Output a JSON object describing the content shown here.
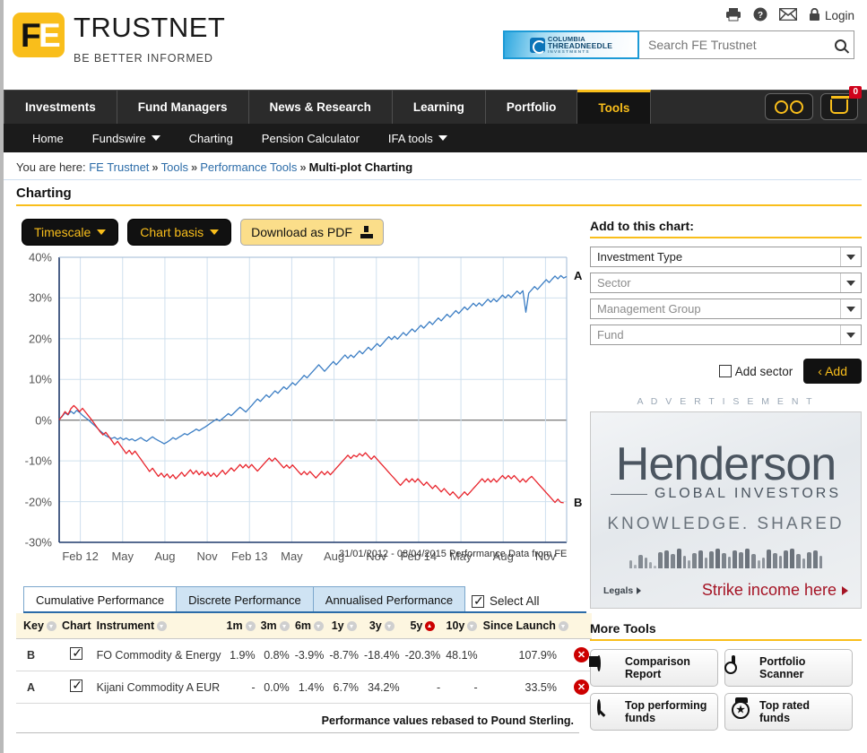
{
  "brand": {
    "logo_f": "F",
    "logo_e": "E",
    "name": "TRUSTNET",
    "tagline": "BE BETTER INFORMED"
  },
  "header": {
    "print_icon": "printer-icon",
    "help_icon": "help-icon",
    "mail_icon": "mail-icon",
    "lock_icon": "lock-icon",
    "login_label": "Login",
    "ad_banner": {
      "line1": "COLUMBIA",
      "line2": "THREADNEEDLE",
      "line3": "INVESTMENTS"
    },
    "search": {
      "placeholder": "Search FE Trustnet",
      "value": "",
      "icon": "search-icon"
    }
  },
  "nav": {
    "items": [
      {
        "label": "Investments",
        "active": false
      },
      {
        "label": "Fund Managers",
        "active": false
      },
      {
        "label": "News & Research",
        "active": false
      },
      {
        "label": "Learning",
        "active": false
      },
      {
        "label": "Portfolio",
        "active": false
      },
      {
        "label": "Tools",
        "active": true
      }
    ],
    "watchlist_icon": "glasses-icon",
    "basket_icon": "basket-icon",
    "basket_count": "0"
  },
  "subnav": {
    "items": [
      {
        "label": "Home",
        "has_caret": false
      },
      {
        "label": "Fundswire",
        "has_caret": true
      },
      {
        "label": "Charting",
        "has_caret": false
      },
      {
        "label": "Pension Calculator",
        "has_caret": false
      },
      {
        "label": "IFA tools",
        "has_caret": true
      }
    ]
  },
  "breadcrumb": {
    "prefix": "You are here:",
    "items": [
      "FE Trustnet",
      "Tools",
      "Performance Tools"
    ],
    "current": "Multi-plot Charting",
    "separator": "»"
  },
  "page_title": "Charting",
  "toolbar": {
    "timescale_label": "Timescale",
    "chart_basis_label": "Chart basis",
    "download_label": "Download as PDF",
    "download_icon": "download-icon"
  },
  "chart_data": {
    "type": "line",
    "title": "",
    "xlabel": "",
    "ylabel": "",
    "ylim": [
      -30,
      40
    ],
    "ytick_labels": [
      "40%",
      "30%",
      "20%",
      "10%",
      "0%",
      "-10%",
      "-20%",
      "-30%"
    ],
    "yticks": [
      40,
      30,
      20,
      10,
      0,
      -10,
      -20,
      -30
    ],
    "xtick_labels": [
      "Feb 12",
      "May",
      "Aug",
      "Nov",
      "Feb 13",
      "May",
      "Aug",
      "Nov",
      "Feb 14",
      "May",
      "Aug",
      "Nov"
    ],
    "grid": true,
    "legend_position": "right-edge-labels",
    "footer_left": "31/01/2012 - 08/04/2015",
    "footer_right": "Performance Data from FE",
    "series": [
      {
        "name": "A",
        "label": "A",
        "instrument": "Kijani Commodity A EUR",
        "color": "#3C7EC4",
        "end_value": 33.5,
        "values": [
          0.2,
          0.9,
          1.8,
          1.3,
          2.2,
          1.6,
          2.4,
          1.9,
          1.2,
          0.6,
          0.1,
          -0.6,
          -1.2,
          -1.9,
          -2.6,
          -3.2,
          -3.8,
          -4.2,
          -4.5,
          -4.2,
          -4.7,
          -4.3,
          -4.8,
          -4.4,
          -4.9,
          -4.6,
          -5.1,
          -4.7,
          -4.3,
          -4.8,
          -5.2,
          -4.6,
          -4.1,
          -4.6,
          -5.0,
          -5.4,
          -5.8,
          -5.4,
          -4.9,
          -4.3,
          -4.7,
          -4.2,
          -3.8,
          -3.3,
          -3.6,
          -3.1,
          -2.7,
          -2.2,
          -2.6,
          -2.1,
          -1.7,
          -1.2,
          -0.7,
          -0.2,
          0.3,
          -0.2,
          0.4,
          1.0,
          1.6,
          1.1,
          1.8,
          2.5,
          3.2,
          2.6,
          2.0,
          2.8,
          3.6,
          4.4,
          5.2,
          4.6,
          5.4,
          6.2,
          5.6,
          6.4,
          7.2,
          6.6,
          7.4,
          8.2,
          7.6,
          8.4,
          9.2,
          8.6,
          9.4,
          10.2,
          11.0,
          10.4,
          11.2,
          12.0,
          12.8,
          13.6,
          12.8,
          12.0,
          12.8,
          13.6,
          14.4,
          13.6,
          14.4,
          15.2,
          16.0,
          15.2,
          16.0,
          15.4,
          16.2,
          17.0,
          16.3,
          17.1,
          17.9,
          17.2,
          18.0,
          18.8,
          18.1,
          18.9,
          19.7,
          20.5,
          19.8,
          20.6,
          19.9,
          20.7,
          21.5,
          20.8,
          21.6,
          22.4,
          21.7,
          22.5,
          23.3,
          22.6,
          23.4,
          24.2,
          23.5,
          24.3,
          25.1,
          24.4,
          25.2,
          26.0,
          25.3,
          26.1,
          26.9,
          26.2,
          27.0,
          27.8,
          27.1,
          27.9,
          28.7,
          28.0,
          28.8,
          28.1,
          28.9,
          29.7,
          29.0,
          29.8,
          29.1,
          29.9,
          30.7,
          30.0,
          30.8,
          30.1,
          30.9,
          31.7,
          31.0,
          31.8,
          26.5,
          31.2,
          32.0,
          32.8,
          32.1,
          32.9,
          33.7,
          34.5,
          33.8,
          34.6,
          35.4,
          34.7,
          35.5,
          34.9,
          35.3
        ]
      },
      {
        "name": "B",
        "label": "B",
        "instrument": "FO Commodity & Energy",
        "color": "#E8242C",
        "end_value": -20.3,
        "values": [
          0.1,
          1.0,
          2.1,
          1.4,
          2.8,
          3.6,
          2.9,
          2.1,
          2.9,
          2.0,
          1.1,
          0.2,
          -0.8,
          -1.8,
          -2.8,
          -3.6,
          -3.0,
          -4.0,
          -5.0,
          -6.0,
          -5.2,
          -6.2,
          -7.2,
          -8.2,
          -7.4,
          -8.4,
          -7.6,
          -8.6,
          -9.6,
          -10.6,
          -11.6,
          -12.6,
          -11.8,
          -12.8,
          -13.8,
          -13.0,
          -14.0,
          -13.2,
          -14.2,
          -13.4,
          -14.4,
          -13.6,
          -12.8,
          -13.8,
          -13.0,
          -12.2,
          -13.2,
          -12.4,
          -13.4,
          -12.6,
          -13.6,
          -12.8,
          -13.8,
          -13.0,
          -13.9,
          -13.1,
          -12.3,
          -13.3,
          -12.5,
          -11.7,
          -12.5,
          -11.7,
          -10.9,
          -11.7,
          -10.9,
          -11.7,
          -10.9,
          -11.7,
          -12.5,
          -11.7,
          -10.9,
          -10.1,
          -9.3,
          -10.1,
          -9.3,
          -10.1,
          -10.9,
          -11.7,
          -11.0,
          -11.8,
          -11.0,
          -11.8,
          -12.6,
          -13.4,
          -12.6,
          -13.4,
          -12.6,
          -13.4,
          -14.2,
          -13.4,
          -12.6,
          -13.4,
          -12.6,
          -13.4,
          -12.6,
          -11.8,
          -11.0,
          -10.2,
          -9.4,
          -8.6,
          -9.4,
          -8.6,
          -9.0,
          -8.2,
          -8.8,
          -8.0,
          -8.8,
          -9.6,
          -8.8,
          -9.6,
          -10.4,
          -11.2,
          -12.0,
          -12.8,
          -13.6,
          -14.4,
          -15.2,
          -16.0,
          -15.2,
          -14.4,
          -15.2,
          -14.4,
          -15.2,
          -14.4,
          -15.2,
          -16.0,
          -15.2,
          -16.0,
          -16.8,
          -16.0,
          -16.8,
          -17.6,
          -16.8,
          -17.6,
          -18.4,
          -17.6,
          -18.4,
          -19.2,
          -18.4,
          -17.6,
          -18.4,
          -17.6,
          -16.8,
          -16.0,
          -15.2,
          -14.4,
          -15.2,
          -14.4,
          -15.2,
          -14.4,
          -15.2,
          -14.4,
          -13.6,
          -14.4,
          -13.6,
          -14.4,
          -13.6,
          -14.4,
          -15.2,
          -14.4,
          -15.2,
          -14.4,
          -13.8,
          -14.6,
          -15.4,
          -16.2,
          -17.0,
          -17.8,
          -18.6,
          -19.4,
          -20.2,
          -19.4,
          -20.2,
          -20.3
        ]
      }
    ]
  },
  "tabs": {
    "items": [
      {
        "label": "Cumulative Performance",
        "active": true
      },
      {
        "label": "Discrete Performance",
        "active": false
      },
      {
        "label": "Annualised Performance",
        "active": false
      }
    ],
    "select_all_label": "Select All",
    "select_all_checked": true
  },
  "table": {
    "columns": [
      {
        "label": "Key",
        "sortable": true,
        "sorted": false
      },
      {
        "label": "Chart",
        "sortable": false,
        "sorted": false
      },
      {
        "label": "Instrument",
        "sortable": true,
        "sorted": false
      },
      {
        "label": "1m",
        "sortable": true,
        "sorted": false
      },
      {
        "label": "3m",
        "sortable": true,
        "sorted": false
      },
      {
        "label": "6m",
        "sortable": true,
        "sorted": false
      },
      {
        "label": "1y",
        "sortable": true,
        "sorted": false
      },
      {
        "label": "3y",
        "sortable": true,
        "sorted": false
      },
      {
        "label": "5y",
        "sortable": true,
        "sorted": true
      },
      {
        "label": "10y",
        "sortable": true,
        "sorted": false
      },
      {
        "label": "Since Launch",
        "sortable": true,
        "sorted": false
      }
    ],
    "rows": [
      {
        "key": "B",
        "key_color": "#E0202A",
        "checked": true,
        "instrument": "FO Commodity & Energy",
        "m1": "1.9%",
        "m3": "0.8%",
        "m6": "-3.9%",
        "y1": "-8.7%",
        "y3": "-18.4%",
        "y5": "-20.3%",
        "y10": "48.1%",
        "since_launch": "107.9%",
        "remove_icon": "remove-icon"
      },
      {
        "key": "A",
        "key_color": "#2C6CA8",
        "checked": true,
        "instrument": "Kijani Commodity A EUR",
        "m1": "-",
        "m3": "0.0%",
        "m6": "1.4%",
        "y1": "6.7%",
        "y3": "34.2%",
        "y5": "-",
        "y10": "-",
        "since_launch": "33.5%",
        "remove_icon": "remove-icon"
      }
    ],
    "footnote": "Performance values rebased to Pound Sterling."
  },
  "add_panel": {
    "heading": "Add to this chart:",
    "selects": [
      {
        "value": "Investment Type",
        "is_placeholder": false
      },
      {
        "value": "Sector",
        "is_placeholder": true
      },
      {
        "value": "Management Group",
        "is_placeholder": true
      },
      {
        "value": "Fund",
        "is_placeholder": true
      }
    ],
    "add_sector_label": "Add sector",
    "add_sector_checked": false,
    "add_button_label": "‹ Add"
  },
  "advert": {
    "label": "A D V E R T I S E M E N T",
    "brand": "Henderson",
    "sub": "GLOBAL INVESTORS",
    "strapline": "KNOWLEDGE. SHARED",
    "legals": "Legals",
    "cta": "Strike income here"
  },
  "more_tools": {
    "heading": "More Tools",
    "items": [
      {
        "label": "Comparison\nReport",
        "l1": "Comparison",
        "l2": "Report",
        "icon": "pie-chart-icon"
      },
      {
        "label": "Portfolio Scanner",
        "l1": "Portfolio",
        "l2": "Scanner",
        "icon": "folder-search-icon"
      },
      {
        "label": "Top performing funds",
        "l1": "Top performing",
        "l2": "funds",
        "icon": "magnifier-chart-icon"
      },
      {
        "label": "Top rated funds",
        "l1": "Top rated",
        "l2": "funds",
        "icon": "medal-star-icon"
      }
    ]
  }
}
